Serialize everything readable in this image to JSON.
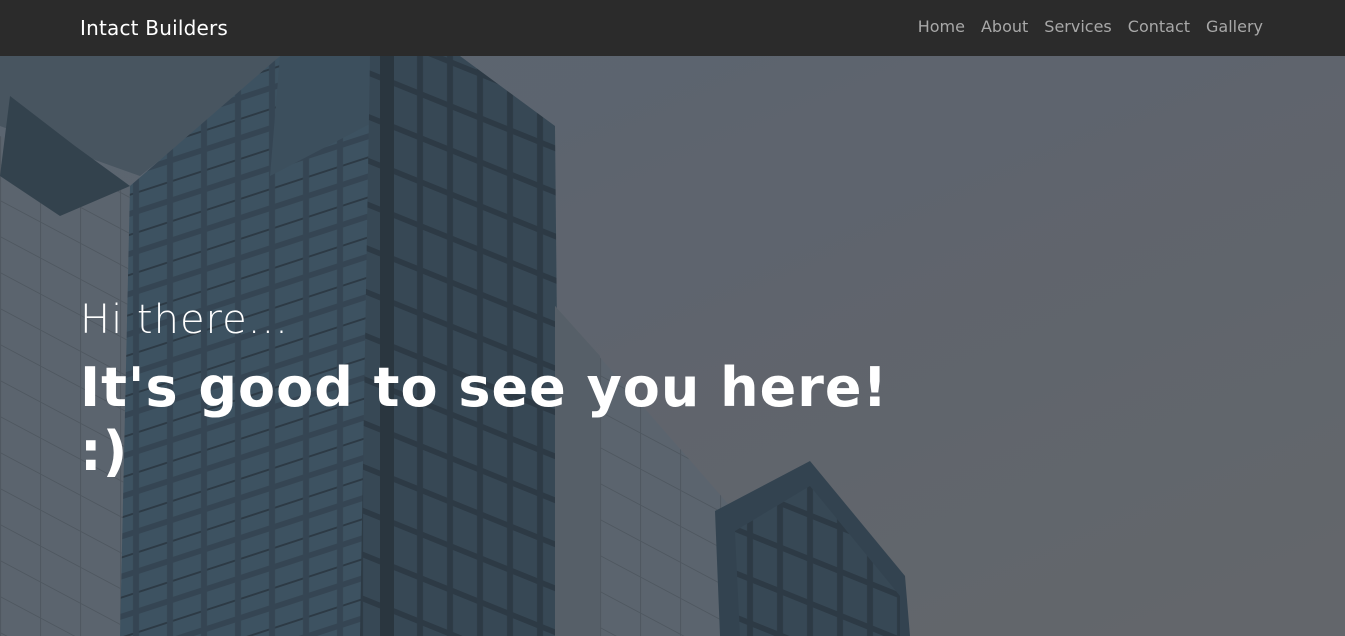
{
  "navbar": {
    "brand": "Intact Builders",
    "links": [
      {
        "label": "Home"
      },
      {
        "label": "About"
      },
      {
        "label": "Services"
      },
      {
        "label": "Contact"
      },
      {
        "label": "Gallery"
      }
    ]
  },
  "hero": {
    "greeting": "Hi there...",
    "headline": "It's good to see you here! :)"
  },
  "colors": {
    "navbar_bg": "#2b2b2b",
    "nav_link": "#a8a8a8",
    "hero_overlay": "#5f656d",
    "text": "#ffffff"
  }
}
